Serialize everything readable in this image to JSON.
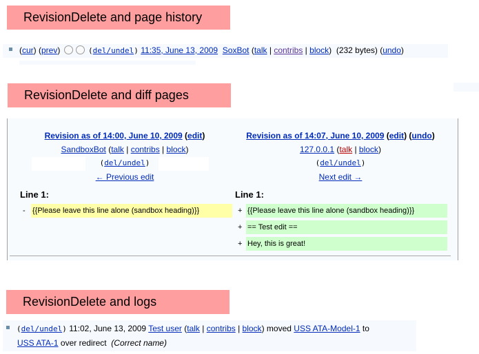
{
  "sections": {
    "history": {
      "title": "RevisionDelete and page history"
    },
    "diff": {
      "title": "RevisionDelete and diff pages"
    },
    "logs": {
      "title": "RevisionDelete and logs"
    }
  },
  "history_row": {
    "cur_label": "cur",
    "prev_label": "prev",
    "deltoggle_label": "del/undel",
    "timestamp": "11:35, June 13, 2009",
    "user": "SoxBot",
    "talk_label": "talk",
    "contribs_label": "contribs",
    "block_label": "block",
    "size": "(232 bytes)",
    "undo_label": "undo"
  },
  "diff": {
    "left": {
      "title": "Revision as of 14:00, June 10, 2009",
      "edit_label": "edit",
      "user": "SandboxBot",
      "talk_label": "talk",
      "contribs_label": "contribs",
      "block_label": "block",
      "deltoggle_label": "del/undel",
      "nav_label": "← Previous edit",
      "line_label": "Line 1:",
      "lines": [
        {
          "sign": "-",
          "text": "{{Please leave this line alone (sandbox heading)}}"
        }
      ]
    },
    "right": {
      "title": "Revision as of 14:07, June 10, 2009",
      "edit_label": "edit",
      "undo_label": "undo",
      "user": "127.0.0.1",
      "talk_label": "talk",
      "block_label": "block",
      "deltoggle_label": "del/undel",
      "nav_label": "Next edit →",
      "line_label": "Line 1:",
      "lines": [
        {
          "sign": "+",
          "text": "{{Please leave this line alone (sandbox heading)}}"
        },
        {
          "sign": "+",
          "text": "== Test edit =="
        },
        {
          "sign": "+",
          "text": "Hey, this is great!"
        }
      ]
    }
  },
  "log_row": {
    "deltoggle_label": "del/undel",
    "timestamp": "11:02, June 13, 2009",
    "user": "Test user",
    "talk_label": "talk",
    "contribs_label": "contribs",
    "block_label": "block",
    "action": "moved",
    "from_page": "USS ATA-Model-1",
    "to_word": "to",
    "to_page": "USS ATA-1",
    "suffix": "over redirect",
    "comment": "(Correct name)"
  },
  "colors": {
    "banner": "#ff9e9e",
    "link": "#002bb8",
    "visited_link": "#5a3696",
    "red_link": "#ba0000",
    "deleted_line": "#ffffa8",
    "added_line": "#cfffcc",
    "diff_background": "#f8fbfe"
  }
}
